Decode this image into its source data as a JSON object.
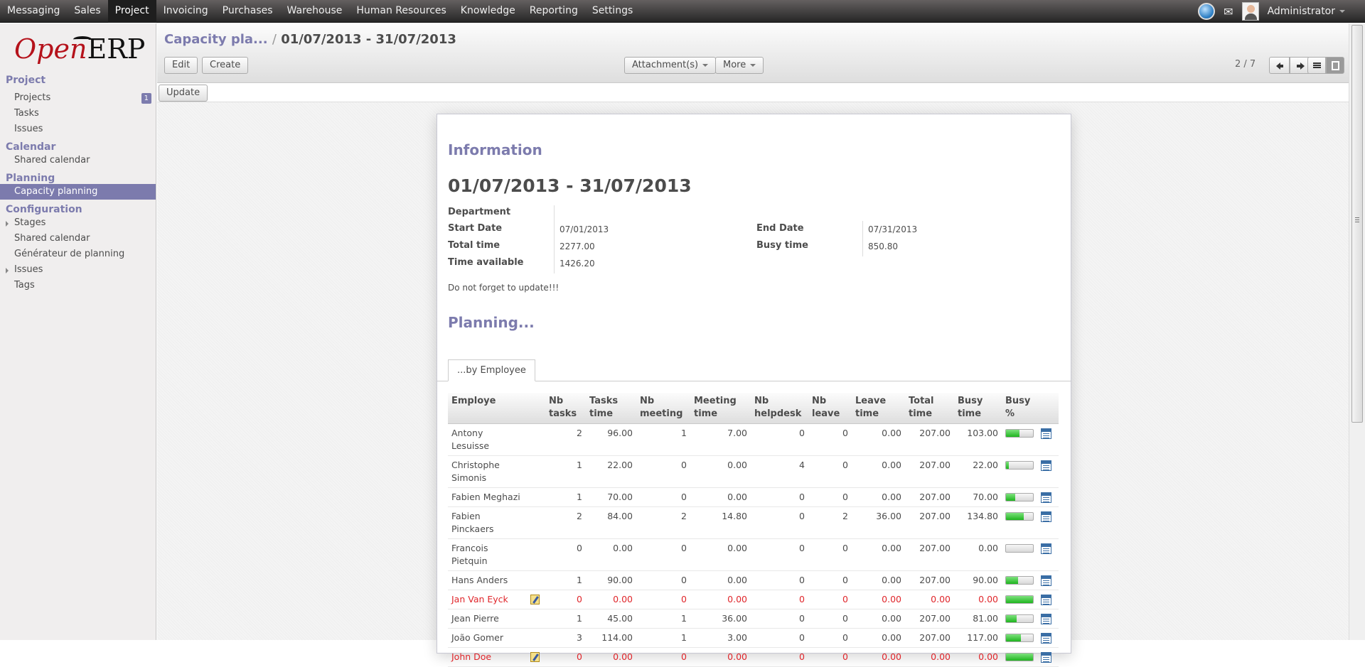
{
  "topmenu": {
    "items": [
      "Messaging",
      "Sales",
      "Project",
      "Invoicing",
      "Purchases",
      "Warehouse",
      "Human Resources",
      "Knowledge",
      "Reporting",
      "Settings"
    ],
    "active": "Project",
    "user": "Administrator",
    "icons": [
      "globe-icon",
      "mail-icon",
      "avatar"
    ]
  },
  "logo": {
    "open": "Open",
    "erp": "ERP"
  },
  "sidebar": {
    "sections": [
      {
        "title": "Project",
        "items": [
          {
            "label": "Projects",
            "badge": "1"
          },
          {
            "label": "Tasks"
          },
          {
            "label": "Issues"
          }
        ]
      },
      {
        "title": "Calendar",
        "items": [
          {
            "label": "Shared calendar"
          }
        ]
      },
      {
        "title": "Planning",
        "items": [
          {
            "label": "Capacity planning",
            "active": true
          }
        ]
      },
      {
        "title": "Configuration",
        "items": [
          {
            "label": "Stages",
            "expandable": true
          },
          {
            "label": "Shared calendar"
          },
          {
            "label": "Générateur de planning"
          },
          {
            "label": "Issues",
            "expandable": true
          },
          {
            "label": "Tags"
          }
        ]
      }
    ]
  },
  "header": {
    "breadcrumb_parent": "Capacity pla...",
    "breadcrumb_sep": "/",
    "breadcrumb_current": "01/07/2013 - 31/07/2013",
    "edit_label": "Edit",
    "create_label": "Create",
    "attachments_label": "Attachment(s)",
    "more_label": "More",
    "pager": "2 / 7"
  },
  "update_label": "Update",
  "form": {
    "info_heading": "Information",
    "title": "01/07/2013 - 31/07/2013",
    "department_label": "Department",
    "department_value": "",
    "start_date_label": "Start Date",
    "start_date_value": "07/01/2013",
    "end_date_label": "End Date",
    "end_date_value": "07/31/2013",
    "total_time_label": "Total time",
    "total_time_value": "2277.00",
    "busy_time_label": "Busy time",
    "busy_time_value": "850.80",
    "time_available_label": "Time available",
    "time_available_value": "1426.20",
    "note": "Do not forget to update!!!",
    "planning_heading": "Planning...",
    "tab_label": "...by Employee"
  },
  "table": {
    "headers": {
      "employe": "Employe",
      "nb_tasks": [
        "Nb",
        "tasks"
      ],
      "tasks_time": [
        "Tasks",
        "time"
      ],
      "nb_meeting": [
        "Nb",
        "meeting"
      ],
      "meeting_time": [
        "Meeting",
        "time"
      ],
      "nb_helpdesk": [
        "Nb",
        "helpdesk"
      ],
      "nb_leave": [
        "Nb",
        "leave"
      ],
      "leave_time": [
        "Leave",
        "time"
      ],
      "total_time": [
        "Total",
        "time"
      ],
      "busy_time": [
        "Busy",
        "time"
      ],
      "busy_pct": [
        "Busy",
        "%"
      ]
    },
    "rows": [
      {
        "name": "Antony Lesuisse",
        "nb_tasks": "2",
        "tasks_time": "96.00",
        "nb_meeting": "1",
        "meeting_time": "7.00",
        "nb_helpdesk": "0",
        "nb_leave": "0",
        "leave_time": "0.00",
        "total_time": "207.00",
        "busy_time": "103.00",
        "busy_pct": 0.498
      },
      {
        "name": "Christophe Simonis",
        "nb_tasks": "1",
        "tasks_time": "22.00",
        "nb_meeting": "0",
        "meeting_time": "0.00",
        "nb_helpdesk": "4",
        "nb_leave": "0",
        "leave_time": "0.00",
        "total_time": "207.00",
        "busy_time": "22.00",
        "busy_pct": 0.106
      },
      {
        "name": "Fabien Meghazi",
        "nb_tasks": "1",
        "tasks_time": "70.00",
        "nb_meeting": "0",
        "meeting_time": "0.00",
        "nb_helpdesk": "0",
        "nb_leave": "0",
        "leave_time": "0.00",
        "total_time": "207.00",
        "busy_time": "70.00",
        "busy_pct": 0.338
      },
      {
        "name": "Fabien Pinckaers",
        "nb_tasks": "2",
        "tasks_time": "84.00",
        "nb_meeting": "2",
        "meeting_time": "14.80",
        "nb_helpdesk": "0",
        "nb_leave": "2",
        "leave_time": "36.00",
        "total_time": "207.00",
        "busy_time": "134.80",
        "busy_pct": 0.651
      },
      {
        "name": "Francois Pietquin",
        "nb_tasks": "0",
        "tasks_time": "0.00",
        "nb_meeting": "0",
        "meeting_time": "0.00",
        "nb_helpdesk": "0",
        "nb_leave": "0",
        "leave_time": "0.00",
        "total_time": "207.00",
        "busy_time": "0.00",
        "busy_pct": 0
      },
      {
        "name": "Hans Anders",
        "nb_tasks": "1",
        "tasks_time": "90.00",
        "nb_meeting": "0",
        "meeting_time": "0.00",
        "nb_helpdesk": "0",
        "nb_leave": "0",
        "leave_time": "0.00",
        "total_time": "207.00",
        "busy_time": "90.00",
        "busy_pct": 0.435
      },
      {
        "name": "Jan Van Eyck",
        "red": true,
        "edit": true,
        "nb_tasks": "0",
        "tasks_time": "0.00",
        "nb_meeting": "0",
        "meeting_time": "0.00",
        "nb_helpdesk": "0",
        "nb_leave": "0",
        "leave_time": "0.00",
        "total_time": "0.00",
        "busy_time": "0.00",
        "busy_pct": 1
      },
      {
        "name": "Jean Pierre",
        "nb_tasks": "1",
        "tasks_time": "45.00",
        "nb_meeting": "1",
        "meeting_time": "36.00",
        "nb_helpdesk": "0",
        "nb_leave": "0",
        "leave_time": "0.00",
        "total_time": "207.00",
        "busy_time": "81.00",
        "busy_pct": 0.391
      },
      {
        "name": "João Gomer",
        "nb_tasks": "3",
        "tasks_time": "114.00",
        "nb_meeting": "1",
        "meeting_time": "3.00",
        "nb_helpdesk": "0",
        "nb_leave": "0",
        "leave_time": "0.00",
        "total_time": "207.00",
        "busy_time": "117.00",
        "busy_pct": 0.565
      },
      {
        "name": "John Doe",
        "red": true,
        "edit": true,
        "nb_tasks": "0",
        "tasks_time": "0.00",
        "nb_meeting": "0",
        "meeting_time": "0.00",
        "nb_helpdesk": "0",
        "nb_leave": "0",
        "leave_time": "0.00",
        "total_time": "0.00",
        "busy_time": "0.00",
        "busy_pct": 1
      }
    ]
  },
  "colors": {
    "accent": "#7c7bad",
    "alert_red": "#e0262b",
    "progress_green": "#1fb51f"
  }
}
